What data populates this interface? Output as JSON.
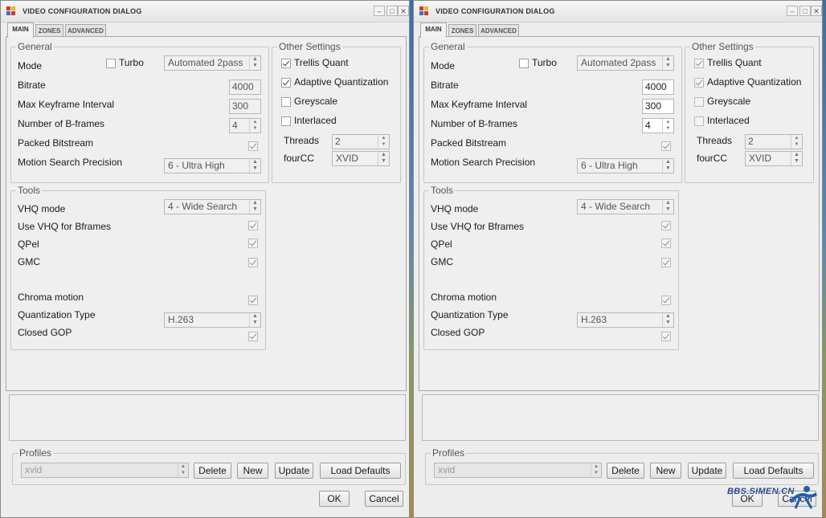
{
  "dialogs": [
    {
      "title": "VIDEO CONFIGURATION DIALOG",
      "tabs": [
        "MAIN",
        "ZONES",
        "ADVANCED"
      ],
      "general": {
        "group_title": "General",
        "mode_label": "Mode",
        "turbo_label": "Turbo",
        "turbo_checked": false,
        "mode_value": "Automated 2pass",
        "bitrate_label": "Bitrate",
        "bitrate_value": "4000",
        "max_keyframe_label": "Max Keyframe Interval",
        "max_keyframe_value": "300",
        "bframes_label": "Number of B-frames",
        "bframes_value": "4",
        "packed_label": "Packed Bitstream",
        "packed_checked": true,
        "motion_label": "Motion Search Precision",
        "motion_value": "6 - Ultra High"
      },
      "other": {
        "group_title": "Other Settings",
        "trellis_label": "Trellis Quant",
        "trellis_checked": true,
        "adaptive_label": "Adaptive Quantization",
        "adaptive_checked": true,
        "greyscale_label": "Greyscale",
        "greyscale_checked": false,
        "interlaced_label": "Interlaced",
        "interlaced_checked": false,
        "threads_label": "Threads",
        "threads_value": "2",
        "fourcc_label": "fourCC",
        "fourcc_value": "XVID"
      },
      "tools": {
        "group_title": "Tools",
        "vhq_label": "VHQ mode",
        "vhq_value": "4 - Wide Search",
        "vhq_bframes_label": "Use VHQ for Bframes",
        "vhq_bframes_checked": true,
        "qpel_label": "QPel",
        "qpel_checked": true,
        "gmc_label": "GMC",
        "gmc_checked": true,
        "chroma_label": "Chroma motion",
        "chroma_checked": true,
        "quant_label": "Quantization Type",
        "quant_value": "H.263",
        "gop_label": "Closed GOP",
        "gop_checked": true
      },
      "profiles": {
        "group_title": "Profiles",
        "profile_value": "xvid",
        "delete_label": "Delete",
        "new_label": "New",
        "update_label": "Update",
        "load_defaults_label": "Load Defaults"
      },
      "ok_label": "OK",
      "cancel_label": "Cancel"
    },
    {
      "title": "VIDEO CONFIGURATION DIALOG",
      "tabs": [
        "MAIN",
        "ZONES",
        "ADVANCED"
      ],
      "general": {
        "group_title": "General",
        "mode_label": "Mode",
        "turbo_label": "Turbo",
        "turbo_checked": false,
        "mode_value": "Automated 2pass",
        "bitrate_label": "Bitrate",
        "bitrate_value": "4000",
        "max_keyframe_label": "Max Keyframe Interval",
        "max_keyframe_value": "300",
        "bframes_label": "Number of B-frames",
        "bframes_value": "4",
        "packed_label": "Packed Bitstream",
        "packed_checked": true,
        "motion_label": "Motion Search Precision",
        "motion_value": "6 - Ultra High"
      },
      "other": {
        "group_title": "Other Settings",
        "trellis_label": "Trellis Quant",
        "trellis_checked": true,
        "adaptive_label": "Adaptive Quantization",
        "adaptive_checked": true,
        "greyscale_label": "Greyscale",
        "greyscale_checked": false,
        "interlaced_label": "Interlaced",
        "interlaced_checked": false,
        "threads_label": "Threads",
        "threads_value": "2",
        "fourcc_label": "fourCC",
        "fourcc_value": "XVID"
      },
      "tools": {
        "group_title": "Tools",
        "vhq_label": "VHQ mode",
        "vhq_value": "4 - Wide Search",
        "vhq_bframes_label": "Use VHQ for Bframes",
        "vhq_bframes_checked": true,
        "qpel_label": "QPel",
        "qpel_checked": true,
        "gmc_label": "GMC",
        "gmc_checked": true,
        "chroma_label": "Chroma motion",
        "chroma_checked": true,
        "quant_label": "Quantization Type",
        "quant_value": "H.263",
        "gop_label": "Closed GOP",
        "gop_checked": true
      },
      "profiles": {
        "group_title": "Profiles",
        "profile_value": "xvid",
        "delete_label": "Delete",
        "new_label": "New",
        "update_label": "Update",
        "load_defaults_label": "Load Defaults"
      },
      "ok_label": "OK",
      "cancel_label": "Cancel"
    }
  ],
  "watermark_text": "BBS.SIMEN.CN",
  "colors": {
    "dialog_bg": "#ededed",
    "title_text": "#333333",
    "icon_red": "#d23a2a",
    "icon_yellow": "#e8b820",
    "icon_blue": "#3a6ec8"
  }
}
